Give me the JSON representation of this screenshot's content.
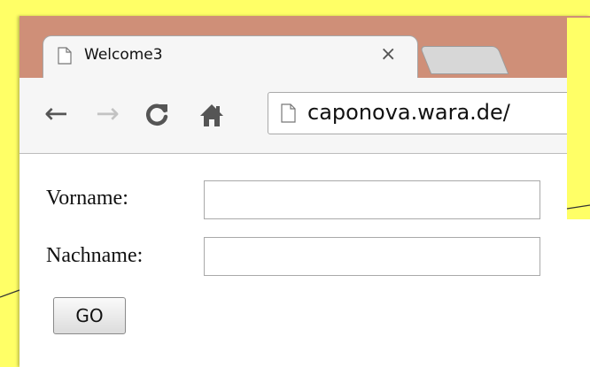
{
  "browser": {
    "tab": {
      "title": "Welcome3",
      "close_glyph": "×"
    },
    "nav": {
      "back_glyph": "←",
      "forward_glyph": "→",
      "reload_icon": "reload-icon",
      "home_icon": "home-icon"
    },
    "address": {
      "url": "caponova.wara.de/"
    }
  },
  "form": {
    "first_name_label": "Vorname:",
    "first_name_value": "",
    "last_name_label": "Nachname:",
    "last_name_value": "",
    "submit_label": "GO"
  },
  "colors": {
    "callout_yellow": "#ffff66",
    "titlebar": "#cf8f78",
    "toolbar": "#f6f6f6"
  }
}
